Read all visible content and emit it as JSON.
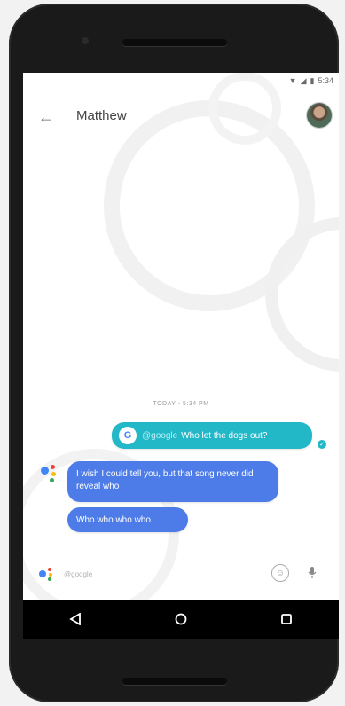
{
  "status_bar": {
    "time": "5:34"
  },
  "conversation": {
    "contact_name": "Matthew",
    "timestamp": "TODAY - 5:34 PM"
  },
  "messages": {
    "user": {
      "chip_label": "@google",
      "text": "Who let the dogs out?"
    },
    "assistant_1": "I wish I could tell you, but that song never did reveal who",
    "assistant_2": "Who who who who"
  },
  "composer": {
    "placeholder": "@google"
  },
  "colors": {
    "user_bubble": "#22b8c8",
    "assistant_bubble": "#4d7ce8",
    "google_blue": "#4285f4",
    "google_red": "#ea4335",
    "google_yellow": "#fbbc05",
    "google_green": "#34a853"
  },
  "icons": {
    "back": "arrow-left-icon",
    "emoji": "smiley-icon",
    "mic": "microphone-icon",
    "nav_back": "triangle-back-icon",
    "nav_home": "circle-home-icon",
    "nav_recents": "square-recents-icon"
  }
}
